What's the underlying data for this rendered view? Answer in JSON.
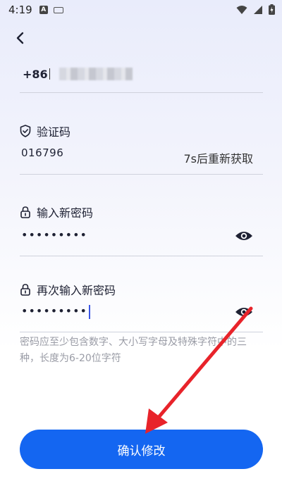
{
  "status_bar": {
    "time": "4:19",
    "notification_icon": "A"
  },
  "phone": {
    "country_code": "+86",
    "separator": "|"
  },
  "verification": {
    "label": "验证码",
    "value": "016796",
    "resend_label": "7s后重新获取"
  },
  "new_password": {
    "label": "输入新密码",
    "value": "•••••••••"
  },
  "confirm_password": {
    "label": "再次输入新密码",
    "value": "•••••••••"
  },
  "hint_text": "密码应至少包含数字、大小写字母及特殊字符中的三种，长度为6-20位字符",
  "confirm_button": {
    "label": "确认修改"
  },
  "colors": {
    "accent": "#1466f1",
    "annotation_arrow": "#e8232a",
    "hint": "#9a9ca6"
  },
  "icons": {
    "back": "chevron-left-icon",
    "shield": "shield-check-icon",
    "lock": "lock-icon",
    "eye": "eye-icon",
    "wifi": "wifi-icon",
    "signal": "signal-icon",
    "battery": "battery-icon"
  }
}
